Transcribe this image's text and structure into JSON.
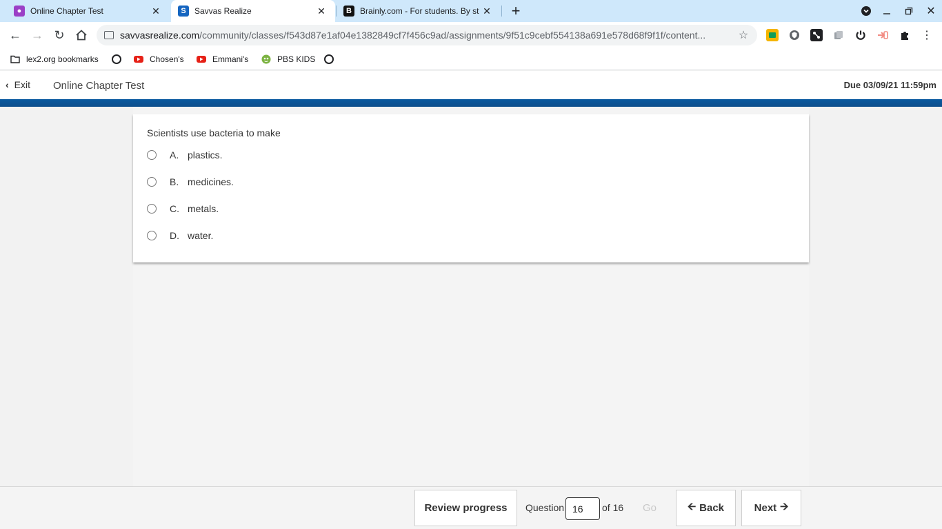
{
  "browser": {
    "tabs": [
      {
        "title": "Online Chapter Test",
        "icon": "classroom-icon",
        "color": "#9b3fc6"
      },
      {
        "title": "Savvas Realize",
        "icon": "savvas-icon",
        "color": "#1565c0"
      },
      {
        "title": "Brainly.com - For students. By st",
        "icon": "brainly-icon",
        "color": "#111111"
      }
    ],
    "url_host": "savvasrealize.com",
    "url_path": "/community/classes/f543d87e1af04e1382849cf7f456c9ad/assignments/9f51c9cebf554138a691e578d68f9f1f/content...",
    "bookmarks": [
      {
        "label": "lex2.org bookmarks",
        "icon": "folder-icon"
      },
      {
        "label": "",
        "icon": "globe-icon"
      },
      {
        "label": "Chosen's",
        "icon": "youtube-icon"
      },
      {
        "label": "Emmani's",
        "icon": "youtube-icon"
      },
      {
        "label": "PBS KIDS",
        "icon": "pbs-kids-icon"
      },
      {
        "label": "",
        "icon": "globe-icon"
      }
    ]
  },
  "header": {
    "exit_label": "Exit",
    "title": "Online Chapter Test",
    "due": "Due 03/09/21 11:59pm"
  },
  "question": {
    "prompt": "Scientists use bacteria to make",
    "choices": [
      {
        "letter": "A.",
        "text": "plastics."
      },
      {
        "letter": "B.",
        "text": "medicines."
      },
      {
        "letter": "C.",
        "text": "metals."
      },
      {
        "letter": "D.",
        "text": "water."
      }
    ]
  },
  "footer": {
    "review_label": "Review progress",
    "question_label": "Question",
    "current": "16",
    "of_label": "of 16",
    "go_label": "Go",
    "back_label": "Back",
    "next_label": "Next"
  },
  "colors": {
    "accent_bar": "#0d4f8b",
    "tab_strip": "#cfe8fb"
  }
}
